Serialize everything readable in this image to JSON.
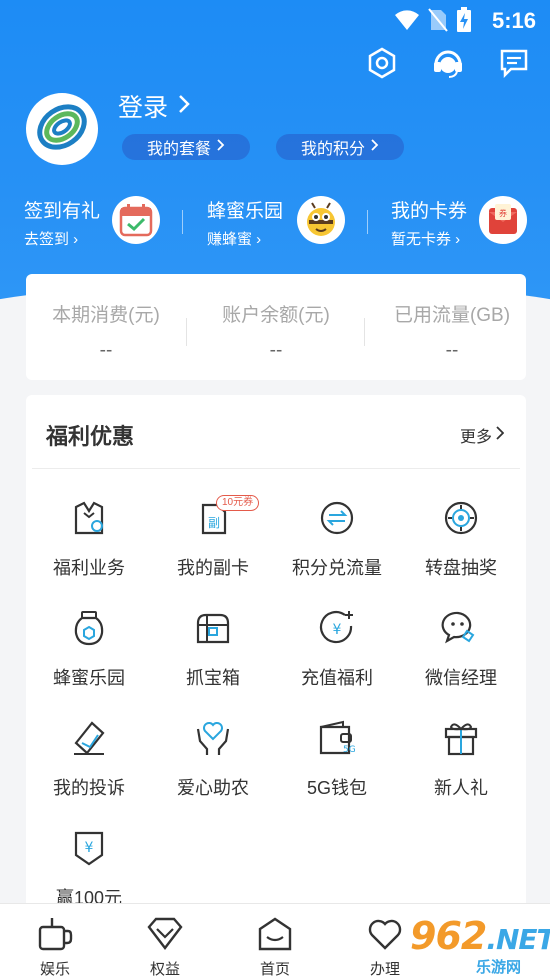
{
  "status_bar": {
    "time": "5:16"
  },
  "header": {
    "login_label": "登录",
    "chips": [
      "我的套餐",
      "我的积分"
    ],
    "quick": [
      {
        "title": "签到有礼",
        "sub": "去签到",
        "icon": "calendar-check-icon"
      },
      {
        "title": "蜂蜜乐园",
        "sub": "赚蜂蜜",
        "icon": "bee-icon"
      },
      {
        "title": "我的卡券",
        "sub": "暂无卡券",
        "icon": "red-envelope-icon"
      }
    ]
  },
  "stats": [
    {
      "label": "本期消费(元)",
      "value": "--"
    },
    {
      "label": "账户余额(元)",
      "value": "--"
    },
    {
      "label": "已用流量(GB)",
      "value": "--"
    }
  ],
  "welfare": {
    "title": "福利优惠",
    "more": "更多",
    "badge": "10元券",
    "items": [
      {
        "label": "福利业务",
        "icon": "suit-icon"
      },
      {
        "label": "我的副卡",
        "icon": "sim-card-icon"
      },
      {
        "label": "积分兑流量",
        "icon": "exchange-icon"
      },
      {
        "label": "转盘抽奖",
        "icon": "wheel-icon"
      },
      {
        "label": "蜂蜜乐园",
        "icon": "honey-jar-icon"
      },
      {
        "label": "抓宝箱",
        "icon": "treasure-box-icon"
      },
      {
        "label": "充值福利",
        "icon": "yuan-coin-icon"
      },
      {
        "label": "微信经理",
        "icon": "wechat-icon"
      },
      {
        "label": "我的投诉",
        "icon": "complaint-icon"
      },
      {
        "label": "爱心助农",
        "icon": "heart-hands-icon"
      },
      {
        "label": "5G钱包",
        "icon": "wallet-5g-icon"
      },
      {
        "label": "新人礼",
        "icon": "gift-icon"
      },
      {
        "label": "赢100元",
        "icon": "yuan-shield-icon"
      }
    ]
  },
  "bottom_nav": [
    {
      "label": "娱乐",
      "icon": "cup-icon"
    },
    {
      "label": "权益",
      "icon": "diamond-icon"
    },
    {
      "label": "首页",
      "icon": "home-icon"
    },
    {
      "label": "办理",
      "icon": "heart-icon"
    }
  ],
  "watermark": {
    "logo": "962",
    "net": ".NET",
    "sub": "乐游网"
  }
}
